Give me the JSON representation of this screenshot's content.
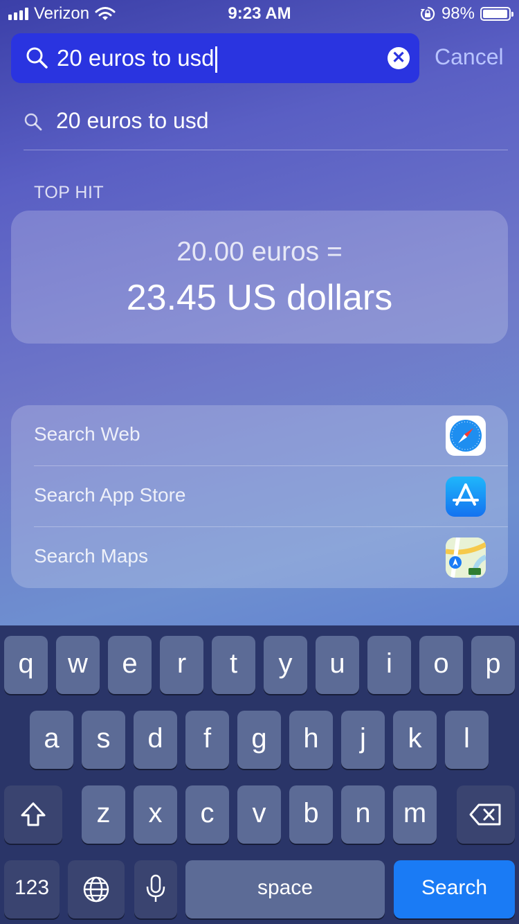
{
  "status_bar": {
    "carrier": "Verizon",
    "time": "9:23 AM",
    "battery_percent": "98%",
    "battery_level": 0.98,
    "icons": [
      "signal-bars-icon",
      "wifi-icon",
      "orientation-lock-icon",
      "battery-icon"
    ]
  },
  "search": {
    "query": "20 euros to usd",
    "clear_icon": "clear-icon",
    "cancel_label": "Cancel"
  },
  "suggestion": {
    "text": "20 euros to usd"
  },
  "top_hit": {
    "section_label": "TOP HIT",
    "line1": "20.00 euros =",
    "line2": "23.45 US dollars"
  },
  "actions": [
    {
      "label": "Search Web",
      "icon": "safari-icon"
    },
    {
      "label": "Search App Store",
      "icon": "app-store-icon"
    },
    {
      "label": "Search Maps",
      "icon": "maps-icon"
    }
  ],
  "keyboard": {
    "row1": [
      "q",
      "w",
      "e",
      "r",
      "t",
      "y",
      "u",
      "i",
      "o",
      "p"
    ],
    "row2": [
      "a",
      "s",
      "d",
      "f",
      "g",
      "h",
      "j",
      "k",
      "l"
    ],
    "row3": [
      "z",
      "x",
      "c",
      "v",
      "b",
      "n",
      "m"
    ],
    "numbers_label": "123",
    "space_label": "space",
    "search_label": "Search",
    "icons": [
      "shift-icon",
      "delete-icon",
      "globe-icon",
      "microphone-icon"
    ]
  },
  "colors": {
    "search_field": "#2a34e0",
    "search_key": "#1a7bf5",
    "keyboard_bg": "#2a3568",
    "key": "#5c6b96"
  }
}
